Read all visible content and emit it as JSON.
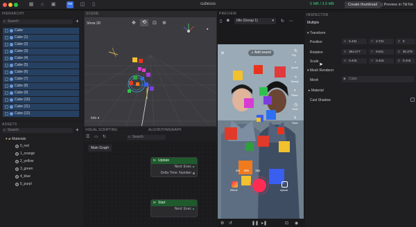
{
  "titlebar": {
    "title": "cubesss",
    "usage": "0 MB / 3.0 MB",
    "create_thumbnail": "Create thumbnail",
    "preview_tiktok": "Preview in TikTok",
    "colors": {
      "close": "#fe5f57",
      "minimize": "#febc2e",
      "zoom": "#28c840",
      "accent": "#3b6fe0"
    }
  },
  "hierarchy": {
    "header": "HIERARCHY",
    "search_placeholder": "Search",
    "items": [
      "Cube",
      "Cube (1)",
      "Cube (2)",
      "Cube (3)",
      "Cube (4)",
      "Cube (5)",
      "Cube (6)",
      "Cube (7)",
      "Cube (8)",
      "Cube (9)",
      "Cube (10)",
      "Cube (11)",
      "Cube (12)"
    ]
  },
  "assets": {
    "header": "ASSETS",
    "search_placeholder": "Search",
    "folder": "Materials",
    "items": [
      "0_red",
      "1_orange",
      "2_yellow",
      "3_green",
      "4_blue",
      "5_purpl"
    ]
  },
  "scene": {
    "header": "SCENE",
    "show3d": "Show 3D",
    "info": "Info"
  },
  "visual_scripting": {
    "header": "VISUAL SCRIPTING",
    "algorithm_header": "ALGORITHMGRAPH",
    "search_placeholder": "Search",
    "main_graph": "Main Graph",
    "node_update": {
      "title": "Update",
      "next": "Next: Exec",
      "delta": "Delta Time: Number"
    },
    "node_start": {
      "title": "Start",
      "next": "Next: Exec"
    }
  },
  "preview": {
    "header": "PREVIEW",
    "mode": "Idle (Group 1)",
    "add_sound": "Add sound",
    "side_labels": [
      "Flip",
      "Speed",
      "Beauty",
      "Filters",
      "Timer",
      "Flash"
    ],
    "durations": [
      "3m",
      "60s",
      "15s"
    ],
    "effects_label": "Effects",
    "upload_label": "Upload"
  },
  "inspector": {
    "header": "INSPECTOR",
    "object": "Multiple",
    "transform": "Transform",
    "position": {
      "label": "Position",
      "x": "5.431",
      "y": "2.721",
      "z": "0"
    },
    "rotation": {
      "label": "Rotation",
      "x": "354.477",
      "y": "9.611",
      "z": "30.278"
    },
    "scale": {
      "label": "Scale",
      "x": "0.416",
      "y": "0.416",
      "z": "0.416"
    },
    "mesh_renderer": "Mesh Renderer",
    "mesh": {
      "label": "Mesh",
      "value": "Cube"
    },
    "material": "Material",
    "cast_shadow": "Cast Shadow"
  }
}
